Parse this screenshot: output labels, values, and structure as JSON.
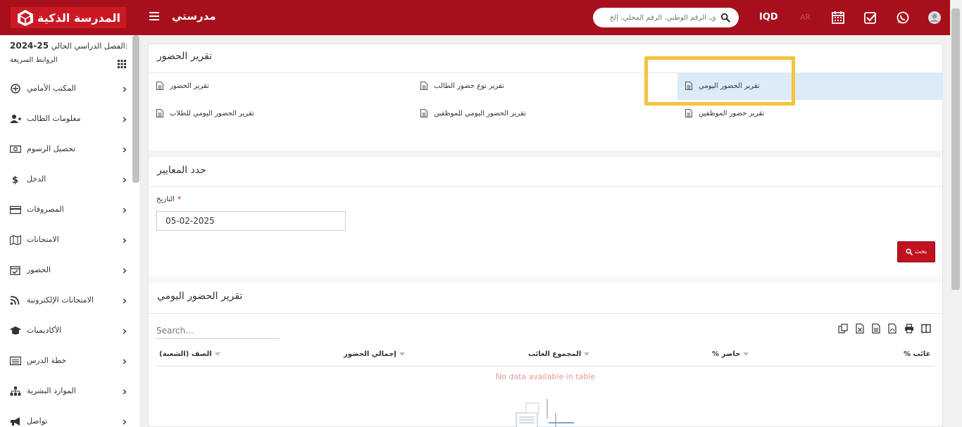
{
  "header": {
    "brand_title": "المدرسة الذكية",
    "app_name": "مدرستي",
    "search_placeholder": "ي، الرقم الوطني، الرقم المحلي، إلخ",
    "currency": "IQD",
    "language": "AR"
  },
  "sidebar": {
    "session_label": "الفصل الدراسي الحالي:",
    "session_value": "2024-25",
    "quick_links": "الروابط السريعة",
    "items": [
      {
        "label": "المكتب الأمامي",
        "icon": "front-office-icon"
      },
      {
        "label": "معلومات الطالب",
        "icon": "user-plus-icon"
      },
      {
        "label": "تحصيل الرسوم",
        "icon": "money-icon"
      },
      {
        "label": "الدخل",
        "icon": "dollar-icon"
      },
      {
        "label": "المصروفات",
        "icon": "credit-card-icon"
      },
      {
        "label": "الامتحانات",
        "icon": "map-icon"
      },
      {
        "label": "الحضور",
        "icon": "calendar-check-icon"
      },
      {
        "label": "الامتحانات الإلكترونية",
        "icon": "rss-icon"
      },
      {
        "label": "الأكاديميات",
        "icon": "graduation-cap-icon"
      },
      {
        "label": "خطة الدرس",
        "icon": "list-icon"
      },
      {
        "label": "الموارد البشرية",
        "icon": "sitemap-icon"
      },
      {
        "label": "تواصل",
        "icon": "bullhorn-icon"
      }
    ]
  },
  "attendance_report": {
    "title": "تقرير الحضور",
    "links": [
      {
        "label": "تقرير الحضور اليومي"
      },
      {
        "label": "تقرير نوع حضور الطالب"
      },
      {
        "label": "تقرير الحضور"
      },
      {
        "label": "تقرير حضور الموظفين"
      },
      {
        "label": "تقرير الحضور اليومي للموظفين"
      },
      {
        "label": "تقرير الحضور اليومي للطلاب"
      }
    ]
  },
  "criteria": {
    "title": "حدد المعايير",
    "date_label": "التاريخ",
    "date_required": "*",
    "date_value": "05-02-2025",
    "search_button": "بحث"
  },
  "daily_report": {
    "title": "تقرير الحضور اليومي",
    "search_placeholder": "Search...",
    "columns": [
      "الصف (الشعبة)",
      "إجمالي الحضور",
      "المجموع الغائب",
      "% حاضر",
      "% غائب"
    ],
    "empty_text": "No data available in table"
  },
  "colors": {
    "primary": "#a80f1c",
    "highlight": "#dcebf8",
    "callout": "#f4c43b"
  }
}
